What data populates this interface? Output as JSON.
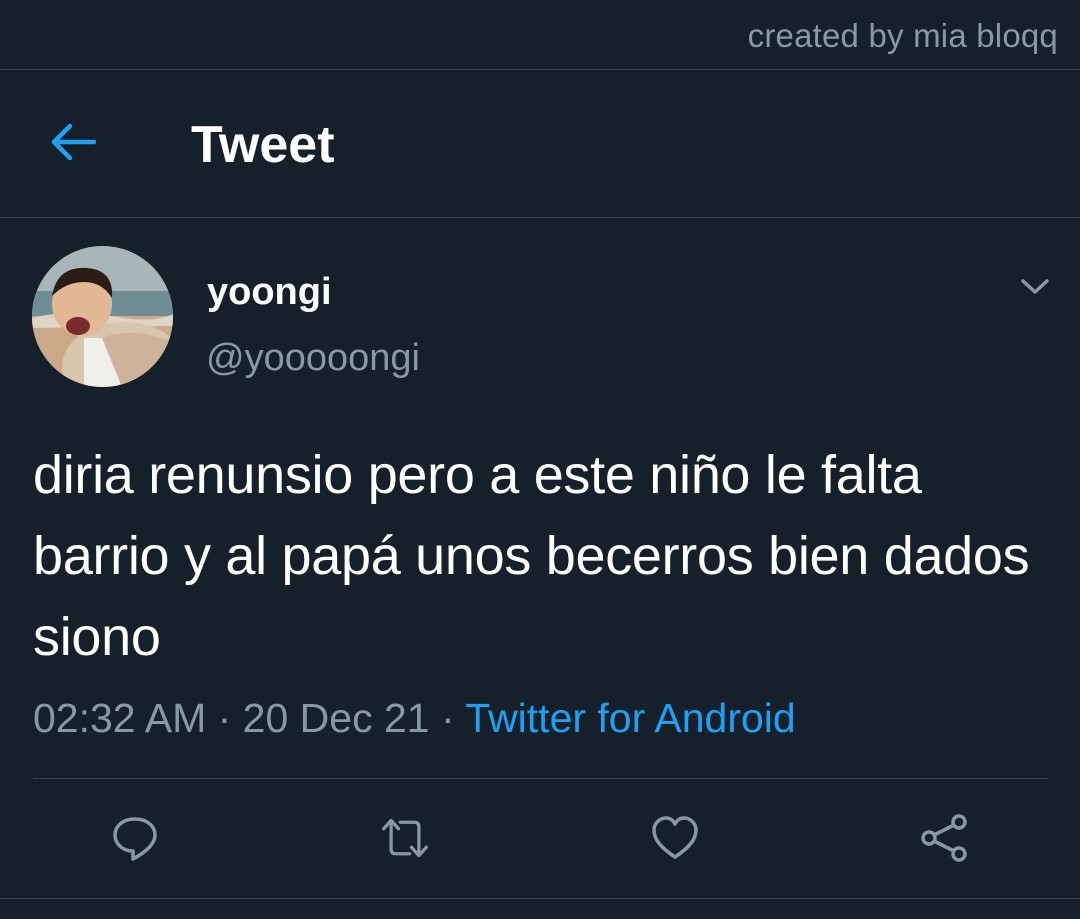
{
  "credit": "created by mia bloqq",
  "header": {
    "title": "Tweet",
    "back_icon": "arrow-left-icon"
  },
  "tweet": {
    "display_name": "yoongi",
    "handle": "@yooooongi",
    "text": "diria renunsio pero a este niño le falta barrio y al papá unos becerros bien dados siono",
    "time": "02:32 AM",
    "separator": " · ",
    "date": "20 Dec 21",
    "source": "Twitter for Android"
  },
  "actions": [
    {
      "name": "reply",
      "icon": "reply-icon"
    },
    {
      "name": "retweet",
      "icon": "retweet-icon"
    },
    {
      "name": "like",
      "icon": "heart-icon"
    },
    {
      "name": "share",
      "icon": "share-icon"
    }
  ],
  "colors": {
    "background": "#15202b",
    "accent": "#1da1f2",
    "secondary_text": "#8899a6",
    "border": "#38444d"
  }
}
